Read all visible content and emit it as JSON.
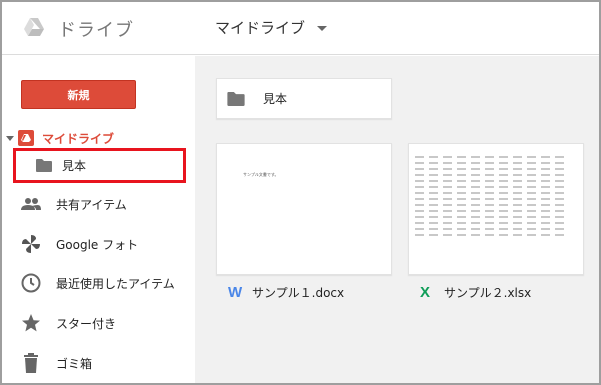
{
  "header": {
    "app_title": "ドライブ",
    "breadcrumb": "マイドライブ"
  },
  "sidebar": {
    "new_button": "新規",
    "my_drive": "マイドライブ",
    "selected_folder": "見本",
    "items": [
      {
        "label": "共有アイテム",
        "icon": "people-icon"
      },
      {
        "label": "Google フォト",
        "icon": "pinwheel-icon"
      },
      {
        "label": "最近使用したアイテム",
        "icon": "clock-icon"
      },
      {
        "label": "スター付き",
        "icon": "star-icon"
      },
      {
        "label": "ゴミ箱",
        "icon": "trash-icon"
      }
    ]
  },
  "main": {
    "folders": [
      {
        "name": "見本"
      }
    ],
    "files": [
      {
        "name": "サンプル１.docx",
        "type": "word",
        "icon_letter": "W",
        "preview_text": "サンプル文書です。"
      },
      {
        "name": "サンプル２.xlsx",
        "type": "excel",
        "icon_letter": "X"
      }
    ]
  },
  "colors": {
    "accent_red": "#dd4b39",
    "highlight_border": "#e8141e",
    "word_blue": "#4a86e8",
    "excel_green": "#0f9d58"
  }
}
